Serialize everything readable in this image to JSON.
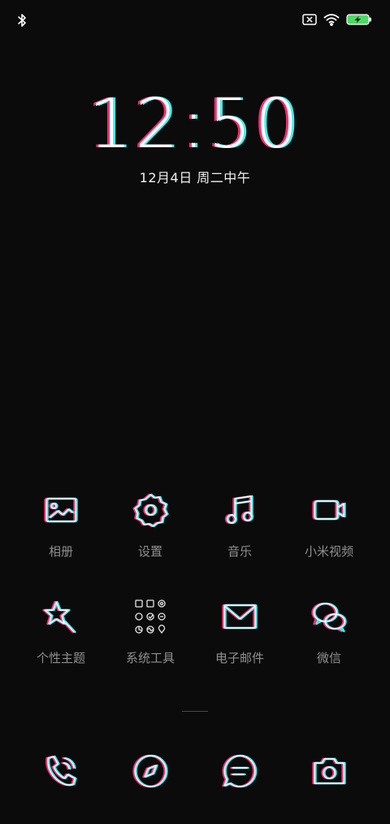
{
  "status_bar": {
    "left_icons": [
      "bluetooth-icon"
    ],
    "right_icons": [
      "no-sim-icon",
      "wifi-icon",
      "battery-charging-icon"
    ]
  },
  "lockscreen": {
    "time": "12:50",
    "date": "12月4日 周二中午"
  },
  "apps": [
    {
      "label": "相册",
      "icon": "gallery-icon"
    },
    {
      "label": "设置",
      "icon": "settings-gear-icon"
    },
    {
      "label": "音乐",
      "icon": "music-note-icon"
    },
    {
      "label": "小米视频",
      "icon": "video-icon"
    },
    {
      "label": "个性主题",
      "icon": "themes-star-icon"
    },
    {
      "label": "系统工具",
      "icon": "system-tools-folder-icon"
    },
    {
      "label": "电子邮件",
      "icon": "email-icon"
    },
    {
      "label": "微信",
      "icon": "wechat-icon"
    }
  ],
  "dock": [
    "phone-icon",
    "browser-compass-icon",
    "messages-icon",
    "camera-icon"
  ],
  "colors": {
    "background": "#0b0b0b",
    "glitch_cyan": "#3ef0f0",
    "glitch_magenta": "#ff2d6f",
    "label": "#8f8f8f"
  }
}
